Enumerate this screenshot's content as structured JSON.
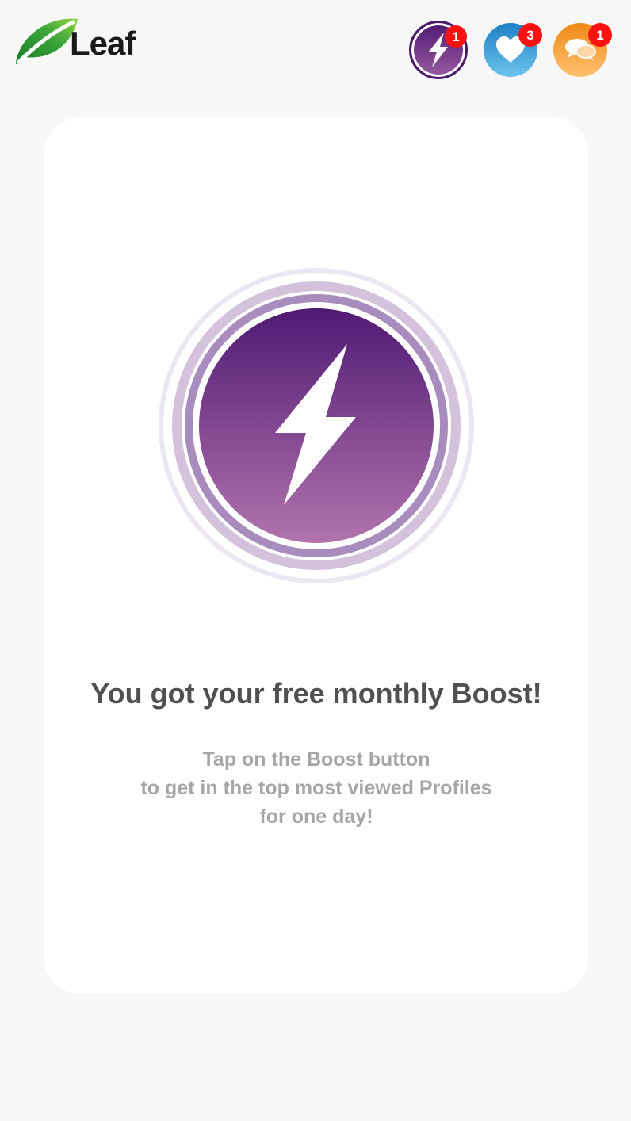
{
  "header": {
    "logo": {
      "text": "Leaf",
      "icon": "leaf-icon",
      "colors": [
        "#1f8a2c",
        "#7ccc3a"
      ]
    },
    "icons": [
      {
        "name": "boost",
        "icon": "lightning-bolt-icon",
        "badge": "1",
        "color": "#5a2278"
      },
      {
        "name": "likes",
        "icon": "heart-icon",
        "badge": "3",
        "color": "#2d8fd0"
      },
      {
        "name": "messages",
        "icon": "chat-bubbles-icon",
        "badge": "1",
        "color": "#f39a2a"
      }
    ]
  },
  "card": {
    "graphic_icon": "lightning-bolt-icon",
    "title": "You got your free monthly Boost!",
    "subtitle_lines": [
      "Tap on the Boost button",
      "to get in the top most viewed Profiles",
      "for one day!"
    ]
  },
  "colors": {
    "background": "#f7f7f7",
    "card": "#ffffff",
    "boost_gradient_top": "#4f1a73",
    "boost_gradient_bottom": "#b273ad",
    "badge": "#ff1111",
    "title": "#505050",
    "subtitle": "#a6a6a6"
  }
}
